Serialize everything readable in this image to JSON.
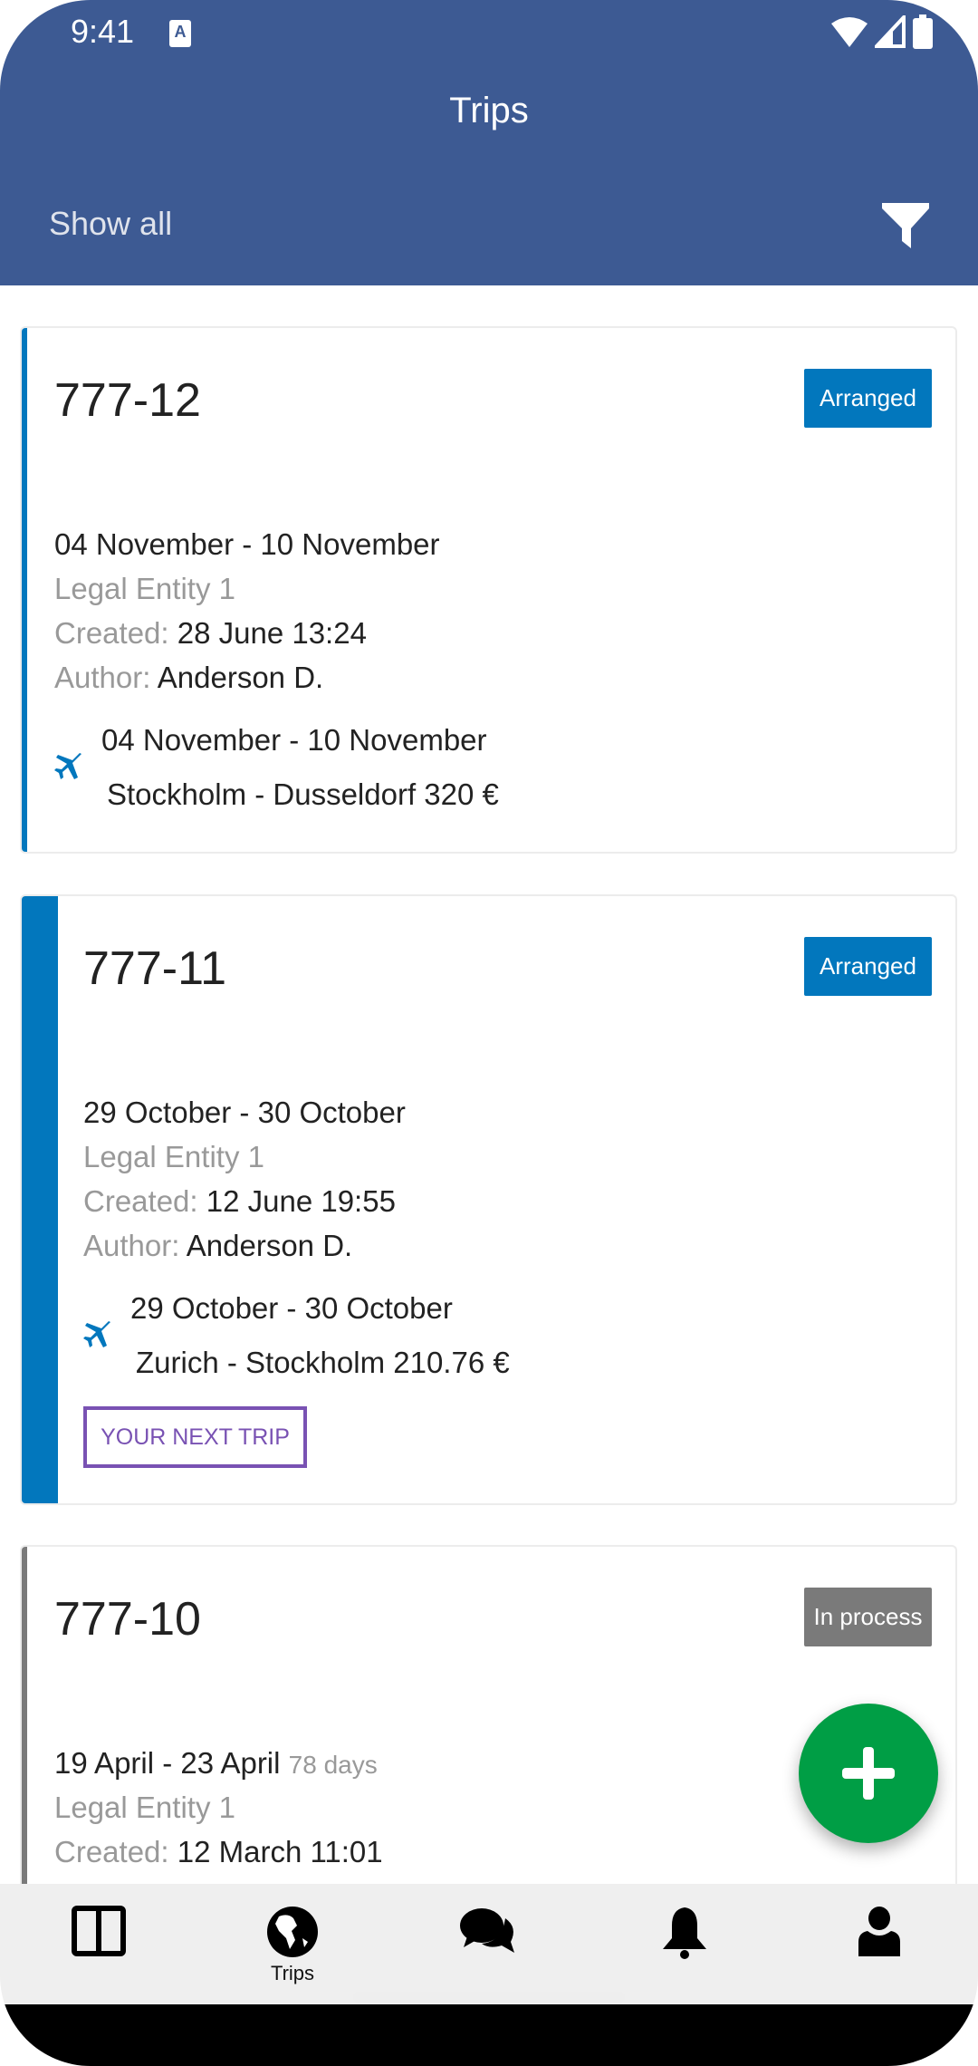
{
  "status_bar": {
    "time": "9:41",
    "notification_icon": "A"
  },
  "header": {
    "title": "Trips",
    "show_all": "Show all",
    "filter_icon": "filter-icon"
  },
  "colors": {
    "header": "#3d5a93",
    "arranged": "#0277bd",
    "in_process": "#7a7a7a",
    "next_trip": "#7952b3",
    "fab": "#009e45"
  },
  "trips": [
    {
      "id": "777-12",
      "status": "Arranged",
      "dates": "04 November - 10 November",
      "entity": "Legal Entity 1",
      "created_label": "Created:",
      "created": "28 June 13:24",
      "author_label": "Author:",
      "author": "Anderson D.",
      "flight_dates": "04 November - 10 November",
      "route": "Stockholm - Dusseldorf 320 €"
    },
    {
      "id": "777-11",
      "status": "Arranged",
      "dates": "29 October - 30 October",
      "entity": "Legal Entity 1",
      "created_label": "Created:",
      "created": "12 June 19:55",
      "author_label": "Author:",
      "author": "Anderson D.",
      "flight_dates": "29 October - 30 October",
      "route": "Zurich - Stockholm 210.76 €",
      "next_trip": "YOUR NEXT TRIP"
    },
    {
      "id": "777-10",
      "status": "In process",
      "dates": "19 April - 23 April",
      "days": "78 days",
      "entity": "Legal Entity 1",
      "created_label": "Created:",
      "created": "12 March 11:01"
    }
  ],
  "nav": {
    "items": [
      {
        "icon": "dashboard-icon",
        "label": ""
      },
      {
        "icon": "globe-icon",
        "label": "Trips",
        "active": true
      },
      {
        "icon": "chat-icon",
        "label": ""
      },
      {
        "icon": "bell-icon",
        "label": ""
      },
      {
        "icon": "user-icon",
        "label": ""
      }
    ]
  }
}
